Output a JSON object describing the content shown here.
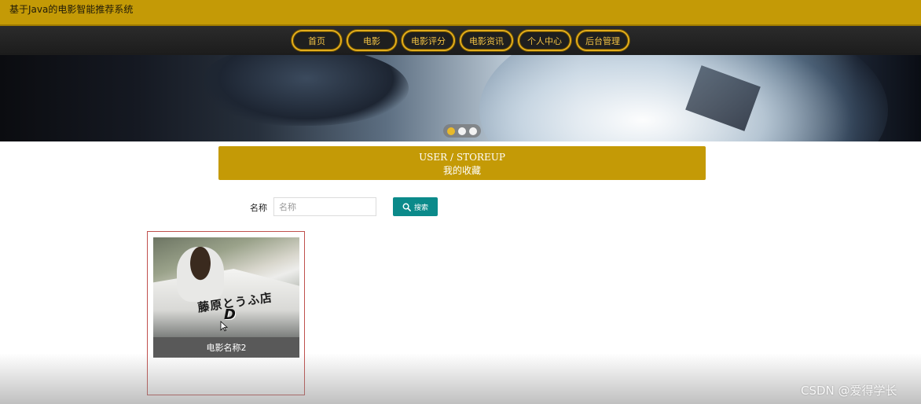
{
  "header": {
    "site_title": "基于Java的电影智能推荐系统"
  },
  "nav": {
    "items": [
      {
        "label": "首页"
      },
      {
        "label": "电影"
      },
      {
        "label": "电影评分"
      },
      {
        "label": "电影资讯"
      },
      {
        "label": "个人中心"
      },
      {
        "label": "后台管理"
      }
    ]
  },
  "carousel": {
    "dots": 3,
    "active_index": 0,
    "colors": {
      "active": "#e8b92b",
      "inactive": "#f2f2f2"
    }
  },
  "section": {
    "title_en": "USER / STOREUP",
    "title_cn": "我的收藏"
  },
  "search": {
    "label": "名称",
    "placeholder": "名称",
    "value": "",
    "button_label": "搜索",
    "button_icon": "search-icon"
  },
  "favorites": [
    {
      "name": "电影名称2",
      "poster_text": "藤原とうふ店",
      "poster_logo": "D"
    }
  ],
  "watermark": "CSDN @爱得学长",
  "colors": {
    "primary": "#c49a06",
    "nav_bg": "#1f1f1f",
    "nav_accent": "#e3ad1c",
    "search_button": "#0b8a8a",
    "card_border": "#c0504d",
    "caption_bg": "#595959"
  }
}
